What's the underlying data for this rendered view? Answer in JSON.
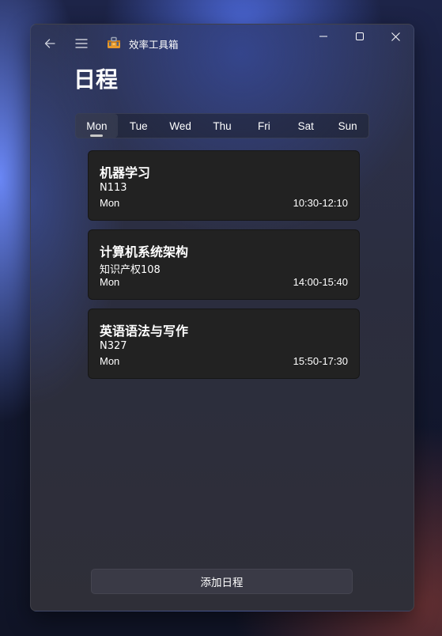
{
  "app": {
    "title": "效率工具箱",
    "icon": "toolbox-icon"
  },
  "window_controls": {
    "minimize_icon": "minimize-icon",
    "maximize_icon": "maximize-icon",
    "close_icon": "close-icon"
  },
  "nav": {
    "back_icon": "back-arrow-icon",
    "menu_icon": "hamburger-menu-icon"
  },
  "page": {
    "title": "日程"
  },
  "days": {
    "selected": "Mon",
    "tabs": [
      "Mon",
      "Tue",
      "Wed",
      "Thu",
      "Fri",
      "Sat",
      "Sun"
    ]
  },
  "courses": [
    {
      "name": "机器学习",
      "room": "N113",
      "day": "Mon",
      "time": "10:30-12:10"
    },
    {
      "name": "计算机系统架构",
      "room": "知识产权108",
      "day": "Mon",
      "time": "14:00-15:40"
    },
    {
      "name": "英语语法与写作",
      "room": "N327",
      "day": "Mon",
      "time": "15:50-17:30"
    }
  ],
  "actions": {
    "add_label": "添加日程"
  },
  "colors": {
    "card_background": "#222222",
    "button_background": "#3a3a46",
    "text": "#ffffff"
  }
}
